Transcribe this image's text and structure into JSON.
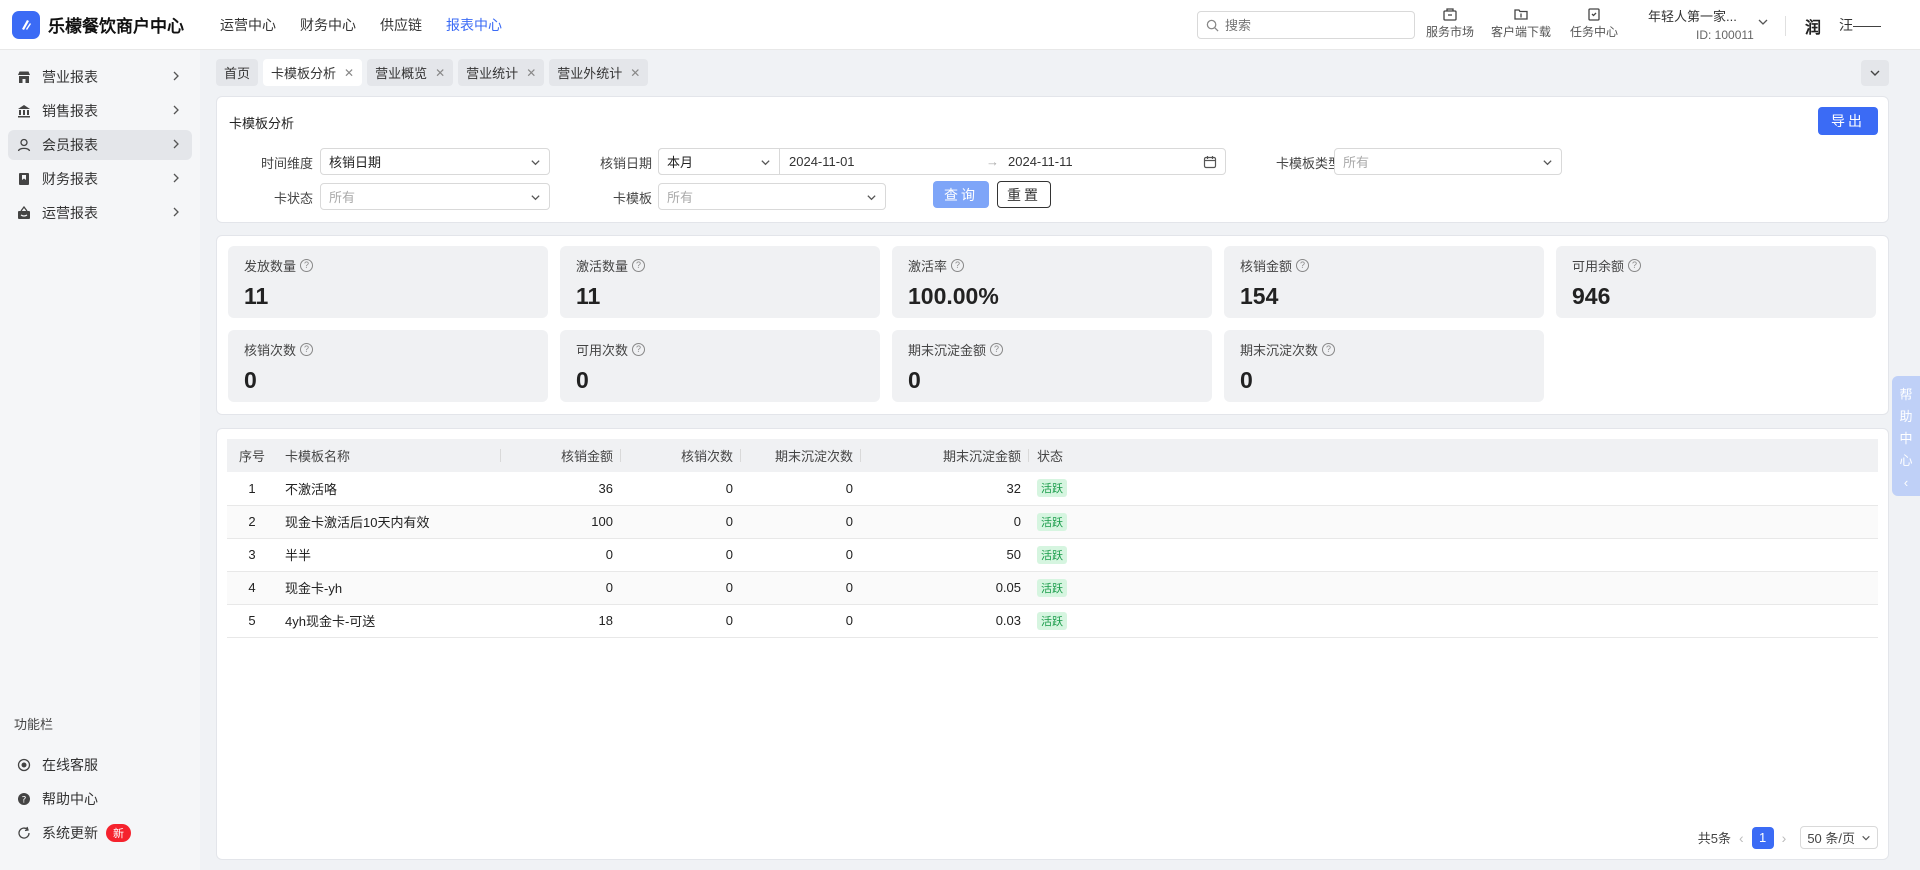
{
  "brand": {
    "name": "乐檬餐饮商户中心"
  },
  "topnav": [
    "运营中心",
    "财务中心",
    "供应链",
    "报表中心"
  ],
  "search": {
    "placeholder": "搜索"
  },
  "tools": [
    "服务市场",
    "客户端下载",
    "任务中心"
  ],
  "account": {
    "name": "年轻人第一家...",
    "id": "ID: 100011"
  },
  "user": {
    "avatar": "润",
    "name": "汪——"
  },
  "sidebar": {
    "items": [
      "营业报表",
      "销售报表",
      "会员报表",
      "财务报表",
      "运营报表"
    ],
    "section": "功能栏",
    "bottom": [
      "在线客服",
      "帮助中心",
      "系统更新"
    ],
    "new_badge": "新"
  },
  "tabs": [
    "首页",
    "卡模板分析",
    "营业概览",
    "营业统计",
    "营业外统计"
  ],
  "filter": {
    "title": "卡模板分析",
    "export": "导出",
    "time_dim_label": "时间维度",
    "time_dim_value": "核销日期",
    "date_label": "核销日期",
    "period": "本月",
    "date_start": "2024-11-01",
    "date_end": "2024-11-11",
    "type_label": "卡模板类型",
    "type_value": "所有",
    "status_label": "卡状态",
    "status_value": "所有",
    "template_label": "卡模板",
    "template_value": "所有",
    "query": "查询",
    "reset": "重置"
  },
  "stats": [
    {
      "label": "发放数量",
      "value": "11"
    },
    {
      "label": "激活数量",
      "value": "11"
    },
    {
      "label": "激活率",
      "value": "100.00%"
    },
    {
      "label": "核销金额",
      "value": "154"
    },
    {
      "label": "可用余额",
      "value": "946"
    },
    {
      "label": "核销次数",
      "value": "0"
    },
    {
      "label": "可用次数",
      "value": "0"
    },
    {
      "label": "期末沉淀金额",
      "value": "0"
    },
    {
      "label": "期末沉淀次数",
      "value": "0"
    }
  ],
  "table": {
    "headers": [
      "序号",
      "卡模板名称",
      "核销金额",
      "核销次数",
      "期末沉淀次数",
      "期末沉淀金额",
      "状态"
    ],
    "rows": [
      [
        "1",
        "不激活咯",
        "36",
        "0",
        "0",
        "32",
        "活跃"
      ],
      [
        "2",
        "现金卡激活后10天内有效",
        "100",
        "0",
        "0",
        "0",
        "活跃"
      ],
      [
        "3",
        "半半",
        "0",
        "0",
        "0",
        "50",
        "活跃"
      ],
      [
        "4",
        "现金卡-yh",
        "0",
        "0",
        "0",
        "0.05",
        "活跃"
      ],
      [
        "5",
        "4yh现金卡-可送",
        "18",
        "0",
        "0",
        "0.03",
        "活跃"
      ]
    ]
  },
  "pager": {
    "total": "共5条",
    "current": "1",
    "size": "50 条/页"
  },
  "help_float": [
    "帮",
    "助",
    "中",
    "心"
  ]
}
